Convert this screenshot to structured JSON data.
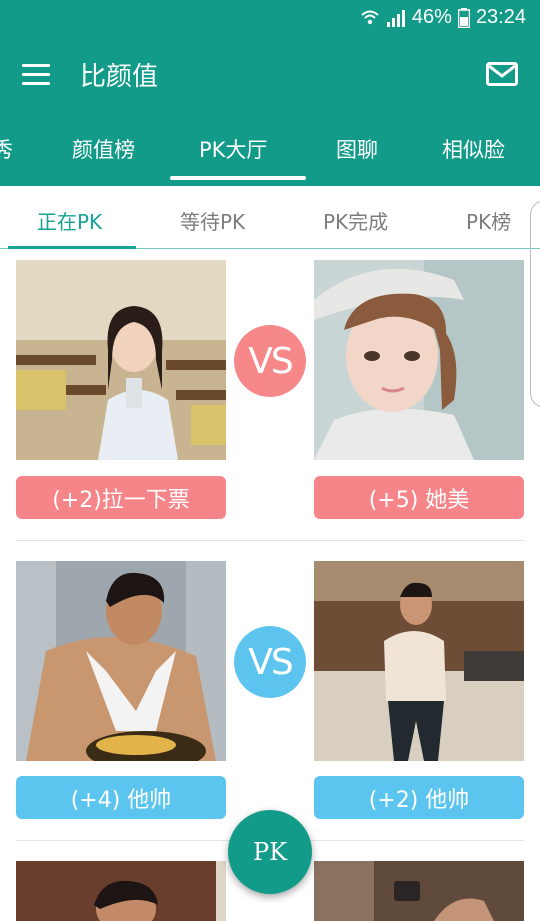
{
  "status": {
    "battery": "46%",
    "time": "23:24"
  },
  "app": {
    "title": "比颜值",
    "menu_icon": "hamburger-menu-icon",
    "mail_icon": "mail-icon"
  },
  "tabs": [
    {
      "label": "秀"
    },
    {
      "label": "颜值榜"
    },
    {
      "label": "PK大厅",
      "active": true
    },
    {
      "label": "图聊"
    },
    {
      "label": "相似脸"
    }
  ],
  "subtabs": [
    {
      "label": "正在PK",
      "active": true
    },
    {
      "label": "等待PK"
    },
    {
      "label": "PK完成"
    },
    {
      "label": "PK榜"
    }
  ],
  "battles": [
    {
      "vs_label": "VS",
      "vs_color": "#f7888a",
      "left": {
        "vote_label": "(+2)拉一下票",
        "button_color": "#f6858a"
      },
      "right": {
        "vote_label": "(+5)  她美",
        "button_color": "#f6858a"
      }
    },
    {
      "vs_label": "VS",
      "vs_color": "#5cc4ef",
      "left": {
        "vote_label": "(+4)  他帅",
        "button_color": "#5bc5f0"
      },
      "right": {
        "vote_label": "(+2)  他帅",
        "button_color": "#5bc5f0"
      }
    }
  ],
  "fab": {
    "label": "PK"
  },
  "colors": {
    "primary": "#139b8a",
    "accent": "#17a396"
  }
}
